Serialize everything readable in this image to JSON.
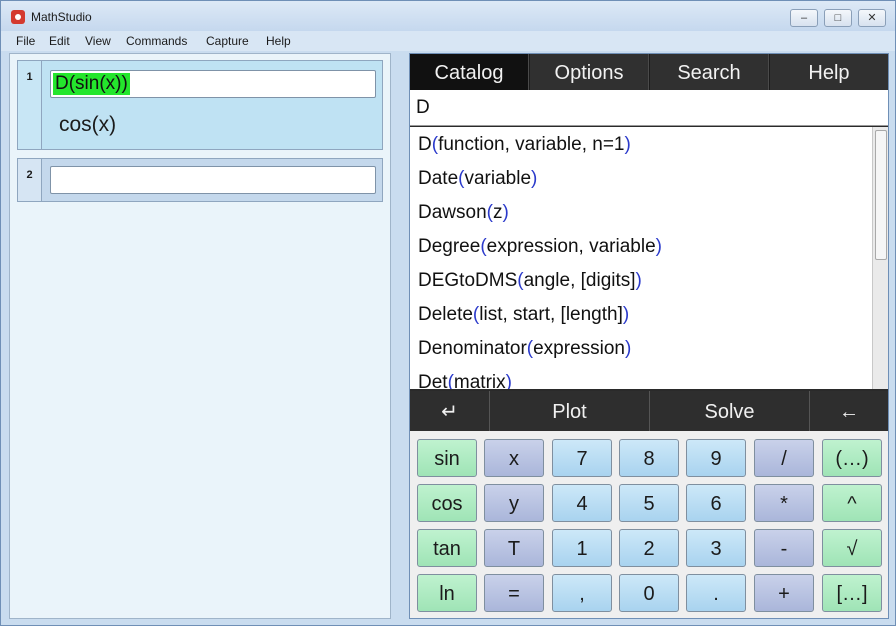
{
  "window": {
    "title": "MathStudio",
    "buttons": [
      "–",
      "□",
      "✕"
    ]
  },
  "menu": [
    "File",
    "Edit",
    "View",
    "Commands",
    "Capture",
    "Help"
  ],
  "cells": [
    {
      "number": "1",
      "input": "D(sin(x))",
      "output": "cos(x)"
    },
    {
      "number": "2",
      "input": "",
      "output": ""
    }
  ],
  "tabs": [
    "Catalog",
    "Options",
    "Search",
    "Help"
  ],
  "search": {
    "value": "D"
  },
  "catalog": [
    {
      "name": "D",
      "args": "function, variable, n=1"
    },
    {
      "name": "Date",
      "args": "variable"
    },
    {
      "name": "Dawson",
      "args": "z"
    },
    {
      "name": "Degree",
      "args": "expression, variable"
    },
    {
      "name": "DEGtoDMS",
      "args": "angle, [digits]"
    },
    {
      "name": "Delete",
      "args": "list, start, [length]"
    },
    {
      "name": "Denominator",
      "args": "expression"
    },
    {
      "name": "Det",
      "args": "matrix"
    }
  ],
  "actions": {
    "enter": "↵",
    "plot": "Plot",
    "solve": "Solve",
    "backspace": "←"
  },
  "keypad": [
    [
      "sin",
      "x",
      "7",
      "8",
      "9",
      "/",
      "(…)"
    ],
    [
      "cos",
      "y",
      "4",
      "5",
      "6",
      "*",
      "^"
    ],
    [
      "tan",
      "T",
      "1",
      "2",
      "3",
      "-",
      "√"
    ],
    [
      "ln",
      "=",
      ",",
      "0",
      ".",
      "+",
      "[…]"
    ]
  ],
  "colors": {
    "highlight": "#24e62c",
    "paren": "#2b3acb",
    "tab_bg": "#111111"
  }
}
